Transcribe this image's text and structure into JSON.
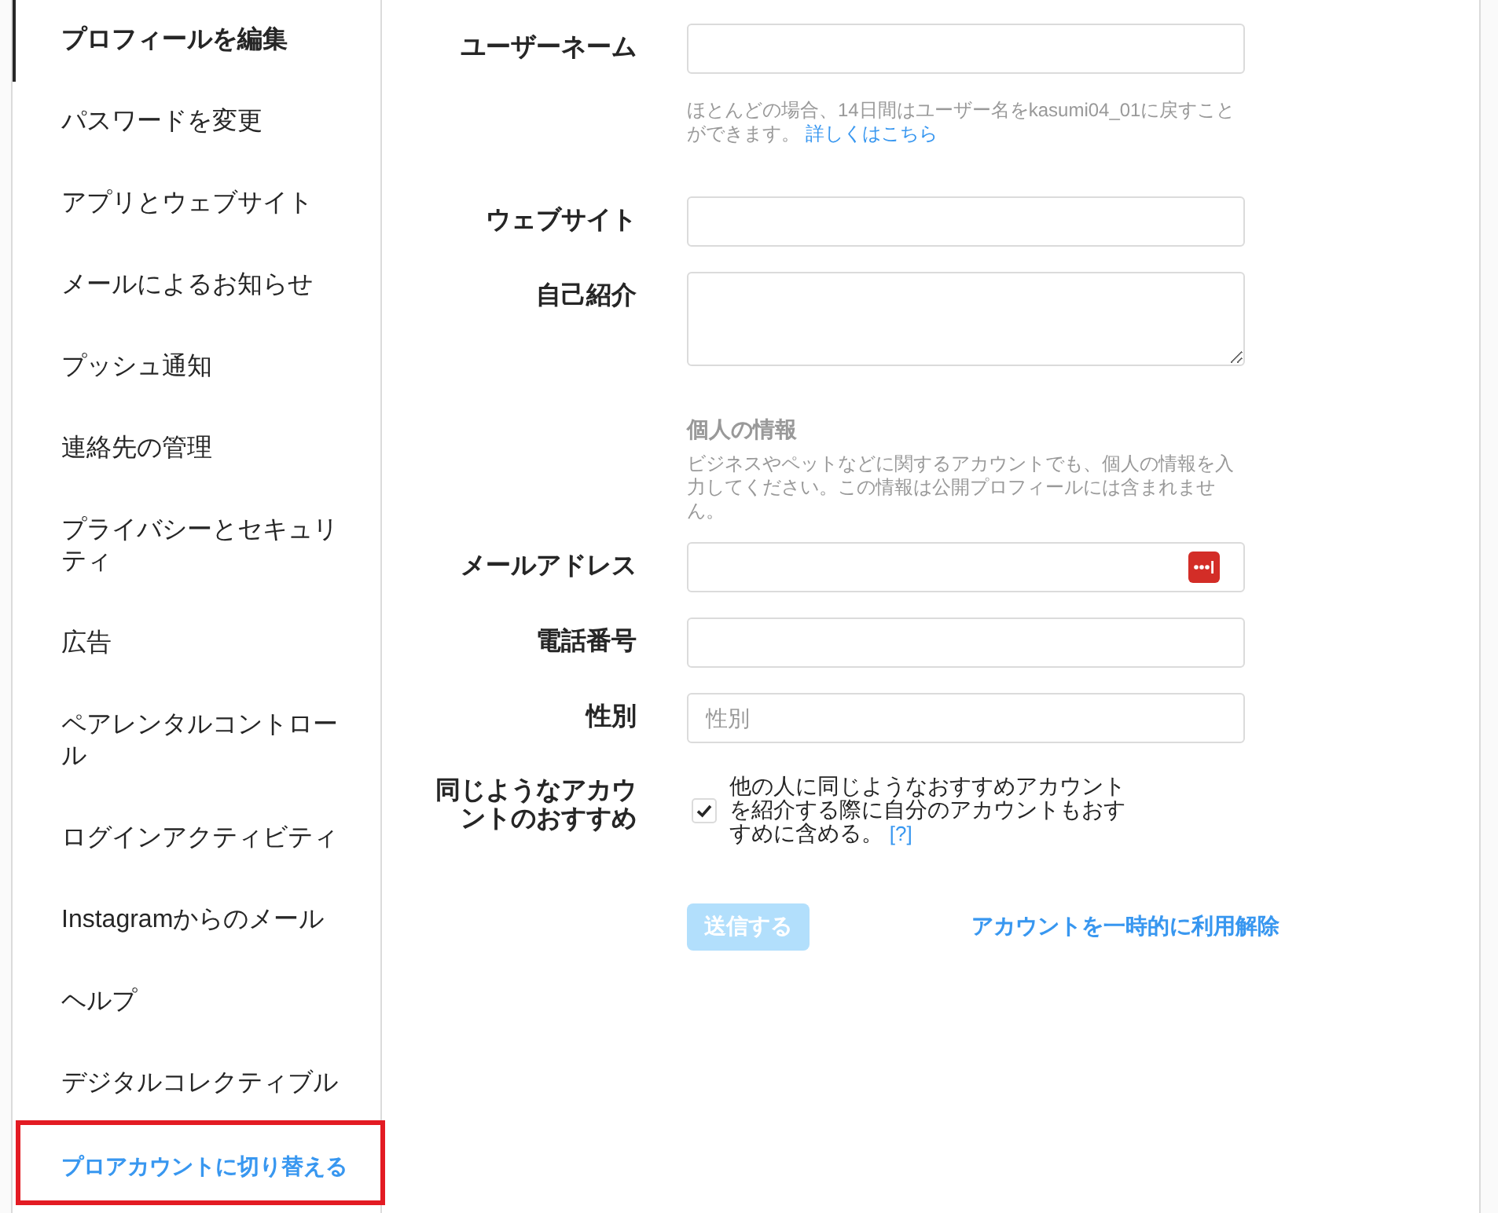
{
  "sidebar": {
    "items": [
      {
        "label": "プロフィールを編集",
        "kind": "menu",
        "selected": true,
        "highlighted": false
      },
      {
        "label": "パスワードを変更",
        "kind": "menu",
        "selected": false,
        "highlighted": false
      },
      {
        "label": "アプリとウェブサイト",
        "kind": "menu",
        "selected": false,
        "highlighted": false
      },
      {
        "label": "メールによるお知らせ",
        "kind": "menu",
        "selected": false,
        "highlighted": false
      },
      {
        "label": "プッシュ通知",
        "kind": "menu",
        "selected": false,
        "highlighted": false
      },
      {
        "label": "連絡先の管理",
        "kind": "menu",
        "selected": false,
        "highlighted": false
      },
      {
        "label": "プライバシーとセキュリティ",
        "kind": "menu",
        "selected": false,
        "highlighted": false
      },
      {
        "label": "広告",
        "kind": "menu",
        "selected": false,
        "highlighted": false
      },
      {
        "label": "ペアレンタルコントロール",
        "kind": "menu",
        "selected": false,
        "highlighted": false
      },
      {
        "label": "ログインアクティビティ",
        "kind": "menu",
        "selected": false,
        "highlighted": false
      },
      {
        "label": "Instagramからのメール",
        "kind": "menu",
        "selected": false,
        "highlighted": false
      },
      {
        "label": "ヘルプ",
        "kind": "menu",
        "selected": false,
        "highlighted": false
      },
      {
        "label": "デジタルコレクティブル",
        "kind": "menu",
        "selected": false,
        "highlighted": false
      },
      {
        "label": "プロアカウントに切り替える",
        "kind": "action",
        "selected": false,
        "highlighted": true
      }
    ]
  },
  "form": {
    "fields": [
      {
        "kind": "text",
        "label": "ユーザーネーム",
        "help": "ほとんどの場合、14日間はユーザー名をkasumi04_01に戻すことができます。",
        "help_link": "詳しくはこちら"
      },
      {
        "kind": "text",
        "label": "ウェブサイト"
      },
      {
        "kind": "textarea",
        "label": "自己紹介"
      },
      {
        "kind": "section",
        "title": "個人の情報",
        "description": "ビジネスやペットなどに関するアカウントでも、個人の情報を入力してください。この情報は公開プロフィールには含まれません。"
      },
      {
        "kind": "text",
        "label": "メールアドレス",
        "autofill_icon": true
      },
      {
        "kind": "text",
        "label": "電話番号"
      },
      {
        "kind": "text",
        "label": "性別",
        "placeholder": "性別"
      },
      {
        "kind": "checkbox",
        "label": "同じようなアカウントのおすすめ",
        "checked": true,
        "text": "他の人に同じようなおすすめアカウントを紹介する際に自分のアカウントもおすすめに含める。",
        "help_link": "[?]"
      }
    ],
    "submit": {
      "label": "送信する",
      "disabled": true
    },
    "deactivate_link": "アカウントを一時的に利用解除"
  }
}
